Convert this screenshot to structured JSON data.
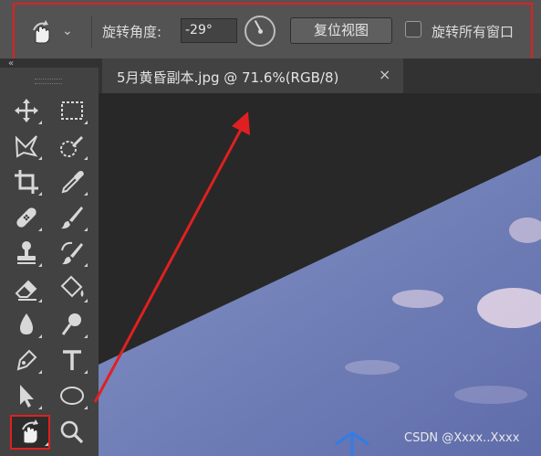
{
  "options_bar": {
    "active_tool_icon": "rotate-view-icon",
    "rotation_angle_label": "旋转角度:",
    "rotation_angle_value": "-29°",
    "reset_view_label": "复位视图",
    "rotate_all_windows_label": "旋转所有窗口",
    "rotate_all_windows_checked": false
  },
  "document_tab": {
    "title": "5月黄昏副本.jpg @ 71.6%(RGB/8)",
    "close_glyph": "×"
  },
  "panel_collapse_glyph": "«",
  "toolbar": {
    "tools": [
      {
        "name": "move-tool",
        "icon": "move-icon"
      },
      {
        "name": "rectangular-marquee-tool",
        "icon": "marquee-icon"
      },
      {
        "name": "lasso-tool",
        "icon": "lasso-icon"
      },
      {
        "name": "quick-selection-tool",
        "icon": "quick-selection-icon"
      },
      {
        "name": "crop-tool",
        "icon": "crop-icon"
      },
      {
        "name": "eyedropper-tool",
        "icon": "eyedropper-icon"
      },
      {
        "name": "healing-brush-tool",
        "icon": "bandage-icon"
      },
      {
        "name": "brush-tool",
        "icon": "brush-icon"
      },
      {
        "name": "clone-stamp-tool",
        "icon": "stamp-icon"
      },
      {
        "name": "history-brush-tool",
        "icon": "history-brush-icon"
      },
      {
        "name": "eraser-tool",
        "icon": "eraser-icon"
      },
      {
        "name": "paint-bucket-tool",
        "icon": "bucket-icon"
      },
      {
        "name": "blur-tool",
        "icon": "drop-icon"
      },
      {
        "name": "dodge-tool",
        "icon": "dodge-icon"
      },
      {
        "name": "pen-tool",
        "icon": "pen-icon"
      },
      {
        "name": "type-tool",
        "icon": "type-icon",
        "glyph": "T"
      },
      {
        "name": "path-selection-tool",
        "icon": "arrow-icon"
      },
      {
        "name": "ellipse-tool",
        "icon": "ellipse-icon"
      },
      {
        "name": "rotate-view-tool",
        "icon": "rotate-view-icon",
        "selected": true
      },
      {
        "name": "zoom-tool",
        "icon": "magnifier-icon"
      }
    ]
  },
  "canvas": {
    "background": "#282828",
    "rotation_deg": -29
  },
  "colors": {
    "highlight": "#e02020",
    "sky_top": "#7f8fc0",
    "sky_bottom": "#6775b2",
    "rotation_cursor": "#2f7de8"
  },
  "watermark": "CSDN @Xxxx..Xxxx"
}
